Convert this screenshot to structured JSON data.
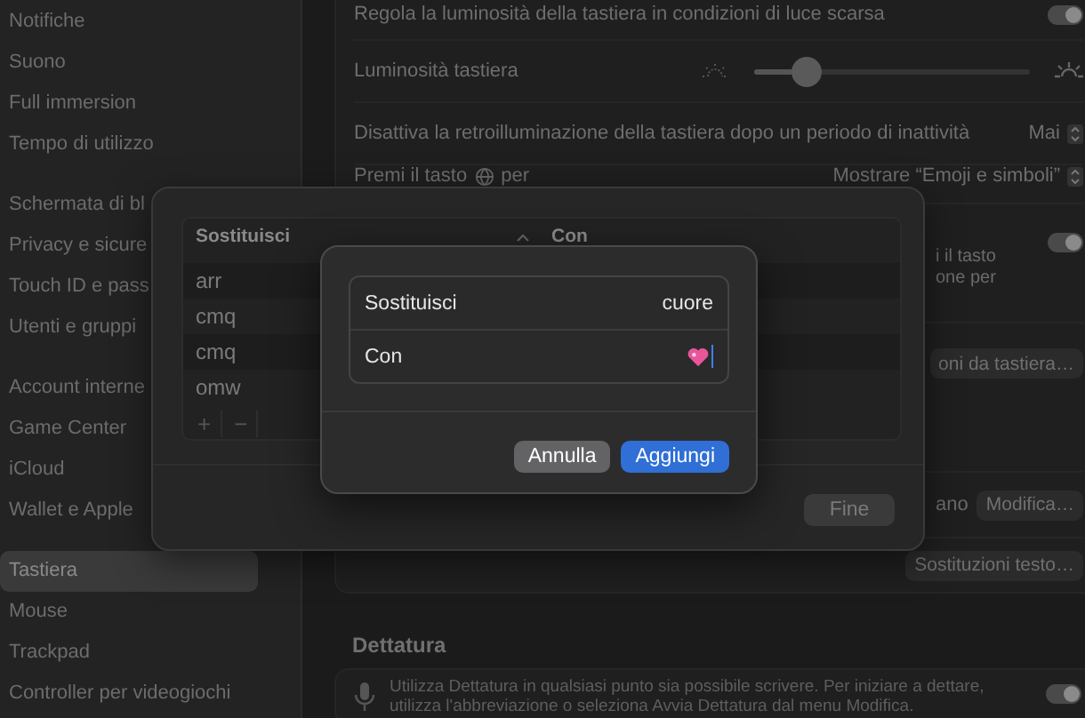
{
  "sidebar": {
    "groups": [
      {
        "items": [
          {
            "label": "Notifiche",
            "selected": false
          },
          {
            "label": "Suono",
            "selected": false
          },
          {
            "label": "Full immersion",
            "selected": false
          },
          {
            "label": "Tempo di utilizzo",
            "selected": false
          }
        ]
      },
      {
        "items": [
          {
            "label": "Schermata di bl",
            "selected": false
          },
          {
            "label": "Privacy e sicure",
            "selected": false
          },
          {
            "label": "Touch ID e pass",
            "selected": false
          },
          {
            "label": "Utenti e gruppi",
            "selected": false
          }
        ]
      },
      {
        "items": [
          {
            "label": "Account interne",
            "selected": false
          },
          {
            "label": "Game Center",
            "selected": false
          },
          {
            "label": "iCloud",
            "selected": false
          },
          {
            "label": "Wallet e Apple",
            "selected": false
          }
        ]
      },
      {
        "items": [
          {
            "label": "Tastiera",
            "selected": true
          },
          {
            "label": "Mouse",
            "selected": false
          },
          {
            "label": "Trackpad",
            "selected": false
          },
          {
            "label": "Controller per videogiochi",
            "selected": false
          }
        ]
      }
    ]
  },
  "settings": {
    "rows": [
      {
        "kind": "toggle",
        "label": "Regola la luminosità della tastiera in condizioni di luce scarsa",
        "on": true
      },
      {
        "kind": "slider",
        "label": "Luminosità tastiera",
        "level": 0.19
      },
      {
        "kind": "popup",
        "label": "Disattiva la retroilluminazione della tastiera dopo un periodo di inattività",
        "value": "Mai"
      },
      {
        "kind": "globe_popup",
        "label_before": "Premi il tasto",
        "label_after": "per",
        "value": "Mostrare “Emoji e simboli”"
      },
      {
        "kind": "note_toggle",
        "lines": [
          "i il tasto",
          "one per"
        ],
        "on": true
      },
      {
        "kind": "button",
        "label": "oni da tastiera…"
      },
      {
        "kind": "note_button",
        "note": "ano",
        "label": "Modifica…"
      },
      {
        "kind": "button",
        "label": "Sostituzioni testo…"
      }
    ]
  },
  "dictation": {
    "title": "Dettatura",
    "text": "Utilizza Dettatura in qualsiasi punto sia possibile scrivere. Per iniziare a dettare, utilizza l'abbreviazione o seleziona Avvia Dettatura dal menu Modifica.",
    "on": true
  },
  "replacements_sheet": {
    "columns": [
      "Sostituisci",
      "Con"
    ],
    "rows": [
      {
        "replace": "arr"
      },
      {
        "replace": "cmq"
      },
      {
        "replace": "cmq"
      },
      {
        "replace": "omw"
      }
    ],
    "add": "+",
    "remove": "−",
    "done": "Fine"
  },
  "dialog": {
    "fields": [
      {
        "kind": "text",
        "label": "Sostituisci",
        "value": "cuore"
      },
      {
        "kind": "emoji",
        "label": "Con"
      }
    ],
    "buttons": [
      {
        "kind": "secondary",
        "label": "Annulla"
      },
      {
        "kind": "primary",
        "label": "Aggiungi"
      }
    ]
  }
}
